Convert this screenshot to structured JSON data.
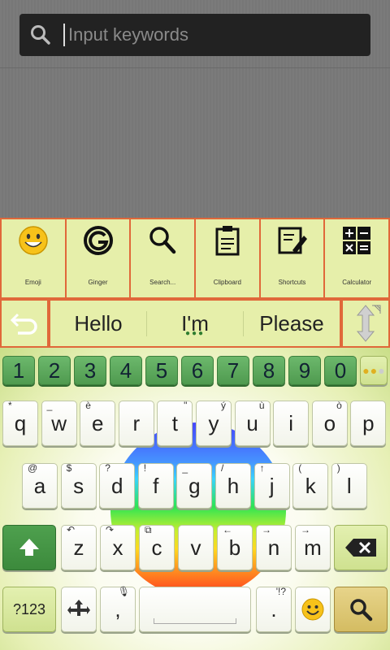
{
  "search": {
    "placeholder": "Input keywords"
  },
  "toolbar": {
    "items": [
      {
        "label": "Emoji",
        "icon": "emoji-icon"
      },
      {
        "label": "Ginger",
        "icon": "ginger-logo-icon"
      },
      {
        "label": "Search...",
        "icon": "magnifier-icon"
      },
      {
        "label": "Clipboard",
        "icon": "clipboard-icon"
      },
      {
        "label": "Shortcuts",
        "icon": "shortcuts-pencil-icon"
      },
      {
        "label": "Calculator",
        "icon": "calculator-icon"
      }
    ]
  },
  "suggestions": {
    "words": [
      "Hello",
      "I'm",
      "Please"
    ],
    "dots": "●●●"
  },
  "keyboard": {
    "numbers": [
      "1",
      "2",
      "3",
      "4",
      "5",
      "6",
      "7",
      "8",
      "9",
      "0"
    ],
    "row1": [
      {
        "k": "q",
        "h": "*"
      },
      {
        "k": "w",
        "h": "_"
      },
      {
        "k": "e",
        "h": "è"
      },
      {
        "k": "r",
        "h": ""
      },
      {
        "k": "t",
        "h": "\""
      },
      {
        "k": "y",
        "h": "ý"
      },
      {
        "k": "u",
        "h": "ù"
      },
      {
        "k": "i",
        "h": ""
      },
      {
        "k": "o",
        "h": "ò"
      },
      {
        "k": "p",
        "h": ""
      }
    ],
    "row2": [
      {
        "k": "a",
        "h": "@"
      },
      {
        "k": "s",
        "h": "$"
      },
      {
        "k": "d",
        "h": "?"
      },
      {
        "k": "f",
        "h": "!"
      },
      {
        "k": "g",
        "h": "_"
      },
      {
        "k": "h",
        "h": "/"
      },
      {
        "k": "j",
        "h": "↑"
      },
      {
        "k": "k",
        "h": "("
      },
      {
        "k": "l",
        "h": ")"
      }
    ],
    "row3": [
      {
        "k": "z",
        "h": "↶"
      },
      {
        "k": "x",
        "h": "↷"
      },
      {
        "k": "c",
        "h": "⧉"
      },
      {
        "k": "v",
        "h": ""
      },
      {
        "k": "b",
        "h": "←"
      },
      {
        "k": "n",
        "h": "→"
      },
      {
        "k": "m",
        "h": "→"
      }
    ],
    "mode_label": "?123",
    "comma": ",",
    "period": ".",
    "period_hint": "'!?",
    "colors": {
      "accent_green": "#4f9a4f",
      "toolbar_border": "#e0683a",
      "toolbar_bg": "#e6efaa"
    }
  }
}
